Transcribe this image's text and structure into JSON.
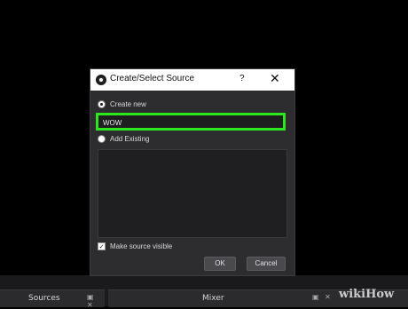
{
  "dialog": {
    "title": "Create/Select Source",
    "help": "?",
    "close": "✕",
    "create_new_label": "Create new",
    "name_value": "WOW",
    "add_existing_label": "Add Existing",
    "make_visible_label": "Make source visible",
    "make_visible_checked": true,
    "checkmark": "✓",
    "ok_label": "OK",
    "cancel_label": "Cancel"
  },
  "docks": {
    "sources_label": "Sources",
    "mixer_label": "Mixer",
    "dock_buttons": "▣ ✕"
  },
  "watermark": "wikiHow",
  "colors": {
    "highlight": "#2ee61e",
    "dialog_bg": "#2d2d30",
    "titlebar_bg": "#ffffff"
  }
}
